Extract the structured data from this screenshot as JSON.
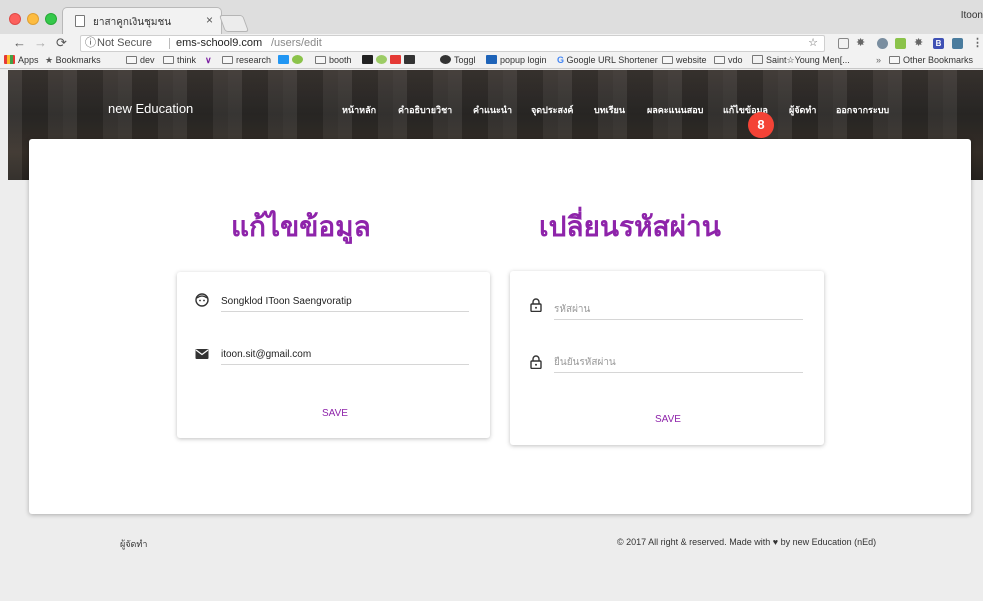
{
  "browser": {
    "tab_title": "ยาสาคูกเงินชุมชน",
    "tab_close": "×",
    "profile": "Itoon",
    "security_label": "Not Secure",
    "url_host": "ems-school9.com",
    "url_path": "/users/edit",
    "bookmarks": [
      "Apps",
      "Bookmarks",
      "dev",
      "think",
      "research",
      "booth",
      "Toggl",
      "popup login",
      "Google URL Shortener",
      "website",
      "vdo",
      "Saint☆Young Men[...",
      "»",
      "Other Bookmarks"
    ]
  },
  "site": {
    "brand": "new Education",
    "menu": [
      "หน้าหลัก",
      "คำอธิบายวิชา",
      "คำแนะนำ",
      "จุดประสงค์",
      "บทเรียน",
      "ผลคะแนนสอบ",
      "แก้ไขข้อมูล",
      "ผู้จัดทำ",
      "ออกจากระบบ"
    ],
    "badge": "8"
  },
  "profile_form": {
    "heading": "แก้ไขข้อมูล",
    "name_value": "Songklod IToon Saengvoratip",
    "email_value": "itoon.sit@gmail.com",
    "save_label": "SAVE"
  },
  "password_form": {
    "heading": "เปลี่ยนรหัสผ่าน",
    "password_placeholder": "รหัสผ่าน",
    "confirm_placeholder": "ยืนยันรหัสผ่าน",
    "save_label": "SAVE"
  },
  "footer": {
    "left": "ผู้จัดทำ",
    "copyright": "© 2017 All right & reserved. Made with",
    "byline": "by new Education (nEd)"
  },
  "colors": {
    "accent": "#8e24aa",
    "badge": "#f44336"
  }
}
